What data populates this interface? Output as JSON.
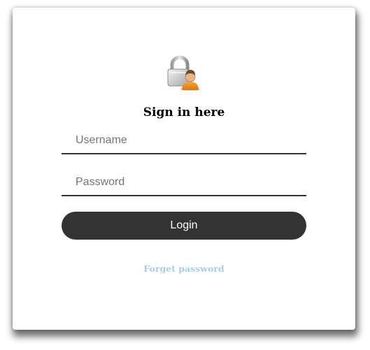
{
  "login_form": {
    "logo_icon": "lock-user-icon",
    "title": "Sign in here",
    "username": {
      "value": "",
      "placeholder": "Username"
    },
    "password": {
      "value": "",
      "placeholder": "Password"
    },
    "login_label": "Login",
    "forget_password_label": "Forget password"
  },
  "colors": {
    "button_background": "#333333",
    "button_text": "#ffffff",
    "link": "#a8cde0",
    "field_underline": "#333333"
  }
}
